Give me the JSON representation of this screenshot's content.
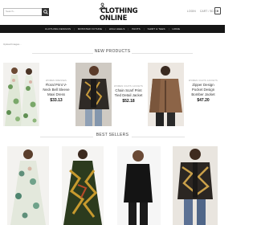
{
  "header": {
    "search_placeholder": "Search...",
    "logo_line1": "CLOTHING",
    "logo_line2": "ONLINE",
    "login": "LOGIN",
    "cart": "CART / $0.00",
    "cart_count": "0"
  },
  "nav": {
    "items": [
      "CLOTHING DESIGNS",
      "MONSTER FUTURE",
      "HIGH HEELS",
      "PANTS",
      "SHIRT & TEES",
      "HOME"
    ]
  },
  "upload_note": "Upload Images...",
  "sections": {
    "new_products": "NEW PRODUCTS",
    "best_sellers": "BEST SELLERS"
  },
  "new_products": [
    {
      "category": "WOMEN DRESSES",
      "name_line1": "Floral Print V-",
      "name_line2": "Neck Bell Sleeve",
      "name_line3": "Maxi Dress",
      "price": "$33.13"
    },
    {
      "category": "WOMEN COATS JACKETS",
      "name_line1": "Chain Scarf Print",
      "name_line2": "Tied Detail Jacket",
      "price": "$52.18"
    },
    {
      "category": "WOMEN COATS JACKETS",
      "name_line1": "Zipper Design",
      "name_line2": "Pocket Design",
      "name_line3": "Bomber Jacket",
      "price": "$47.20"
    }
  ],
  "colors": {
    "nav_bg": "#161616",
    "accent": "#111111"
  }
}
